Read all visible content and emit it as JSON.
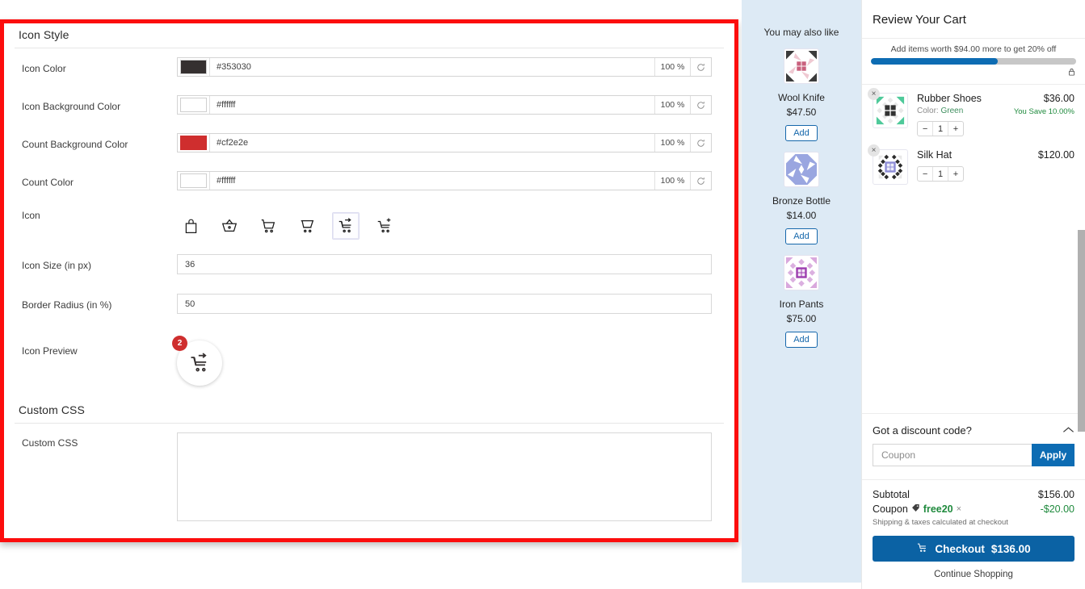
{
  "settings": {
    "sections": [
      {
        "title": "Icon Style"
      },
      {
        "title": "Custom CSS"
      }
    ],
    "icon_style_title": "Icon Style",
    "custom_css_title": "Custom CSS",
    "color_fields": [
      {
        "label": "Icon Color",
        "hex": "#353030",
        "swatch": "#353030",
        "alpha": "100 %",
        "reset": "reset-icon"
      },
      {
        "label": "Icon Background Color",
        "hex": "#ffffff",
        "swatch": "#ffffff",
        "alpha": "100 %",
        "reset": "reset-icon"
      },
      {
        "label": "Count Background Color",
        "hex": "#cf2e2e",
        "swatch": "#cf2e2e",
        "alpha": "100 %",
        "reset": "reset-icon"
      },
      {
        "label": "Count Color",
        "hex": "#ffffff",
        "swatch": "#ffffff",
        "alpha": "100 %",
        "reset": "reset-icon"
      }
    ],
    "icon_field": {
      "label": "Icon",
      "options": [
        {
          "name": "shopping-bag-icon",
          "selected": false
        },
        {
          "name": "shopping-basket-icon",
          "selected": false
        },
        {
          "name": "shopping-cart-icon",
          "selected": false
        },
        {
          "name": "shopping-cart-flat-icon",
          "selected": false
        },
        {
          "name": "cart-arrow-down-icon",
          "selected": true
        },
        {
          "name": "cart-plus-icon",
          "selected": false
        }
      ],
      "selected_index": 4
    },
    "icon_size": {
      "label": "Icon Size (in px)",
      "value": "36"
    },
    "border_radius": {
      "label": "Border Radius (in %)",
      "value": "50"
    },
    "icon_preview": {
      "label": "Icon Preview",
      "badge_count": "2",
      "icon": "cart-arrow-down-icon"
    },
    "custom_css": {
      "label": "Custom CSS",
      "value": "",
      "placeholder": ""
    }
  },
  "recommendations": {
    "title": "You may also like",
    "items": [
      {
        "name": "Wool Knife",
        "price": "$47.50",
        "add_label": "Add",
        "thumb": "wool-knife-thumb"
      },
      {
        "name": "Bronze Bottle",
        "price": "$14.00",
        "add_label": "Add",
        "thumb": "bronze-bottle-thumb"
      },
      {
        "name": "Iron Pants",
        "price": "$75.00",
        "add_label": "Add",
        "thumb": "iron-pants-thumb"
      }
    ]
  },
  "cart": {
    "title": "Review Your Cart",
    "progress": {
      "text": "Add items worth $94.00 more to get 20% off",
      "percent": 62,
      "lock_icon": "lock-icon"
    },
    "items": [
      {
        "name": "Rubber Shoes",
        "variant_label": "Color:",
        "variant_value": "Green",
        "price": "$36.00",
        "savings": "You Save 10.00%",
        "qty": "1",
        "minus": "−",
        "plus": "+",
        "remove": "×",
        "thumb": "rubber-shoes-thumb"
      },
      {
        "name": "Silk Hat",
        "variant_label": "",
        "variant_value": "",
        "price": "$120.00",
        "savings": "",
        "qty": "1",
        "minus": "−",
        "plus": "+",
        "remove": "×",
        "thumb": "silk-hat-thumb"
      }
    ],
    "discount": {
      "heading": "Got a discount code?",
      "collapse_icon": "chevron-up-icon",
      "input_placeholder": "Coupon",
      "input_value": "",
      "apply_label": "Apply"
    },
    "totals": {
      "subtotal_label": "Subtotal",
      "subtotal_value": "$156.00",
      "coupon_label": "Coupon",
      "coupon_code": "free20",
      "coupon_remove": "×",
      "coupon_value": "-$20.00",
      "shipping_note": "Shipping & taxes calculated at checkout"
    },
    "checkout": {
      "label": "Checkout",
      "amount": "$136.00",
      "icon": "cart-icon"
    },
    "continue_label": "Continue Shopping"
  },
  "colors": {
    "highlight_border": "#fc0d0d",
    "accent_blue": "#0d6cb3",
    "checkout_blue": "#0b62a4",
    "savings_green": "#1f8a3d",
    "reco_bg": "#ddeaf5",
    "count_bg": "#cf2e2e",
    "icon_color": "#353030"
  }
}
